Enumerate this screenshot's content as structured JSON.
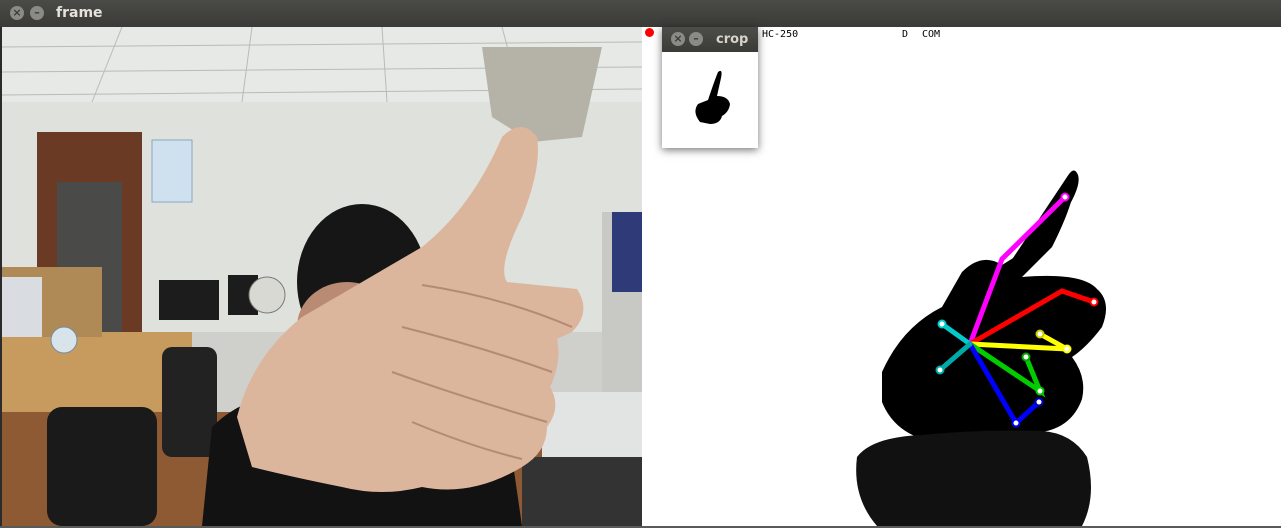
{
  "window": {
    "title": "frame",
    "close_glyph": "×",
    "minimize_glyph": "–"
  },
  "crop_window": {
    "title": "crop",
    "close_glyph": "×",
    "minimize_glyph": "–"
  },
  "overlay": {
    "label": "HC-250",
    "letter": "D",
    "mode": "COM"
  },
  "colors": {
    "thumb": "#ff00ff",
    "index": "#ff0000",
    "middle": "#ffff00",
    "ring": "#00dd00",
    "pinky": "#0000ff",
    "palm": "#00cccc",
    "record_dot": "#ff0000"
  }
}
